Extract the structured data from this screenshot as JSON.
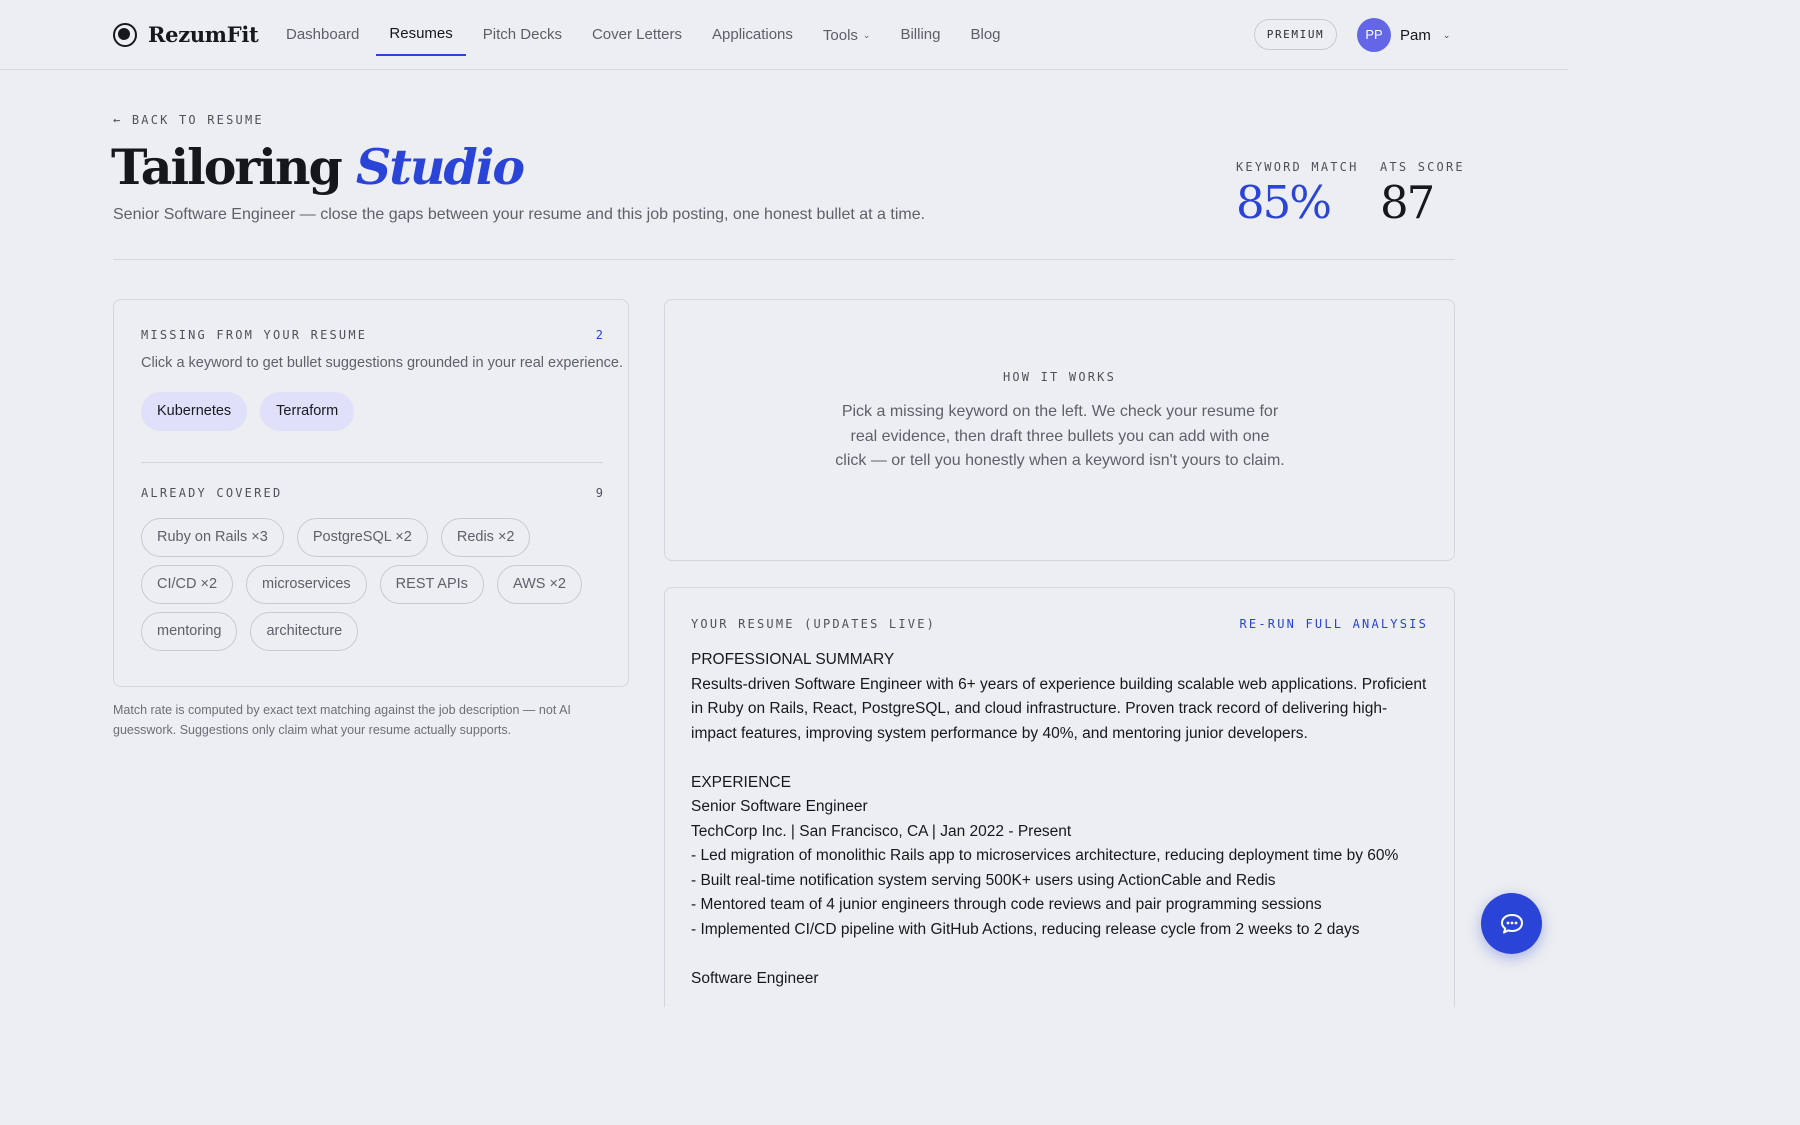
{
  "brand": {
    "name": "RezumFit",
    "logo_icon": "circle-logo-icon"
  },
  "nav": {
    "links": [
      {
        "label": "Dashboard",
        "active": false
      },
      {
        "label": "Resumes",
        "active": true
      },
      {
        "label": "Pitch Decks",
        "active": false
      },
      {
        "label": "Cover Letters",
        "active": false
      },
      {
        "label": "Applications",
        "active": false
      },
      {
        "label": "Tools",
        "active": false,
        "has_dropdown": true
      },
      {
        "label": "Billing",
        "active": false
      },
      {
        "label": "Blog",
        "active": false
      }
    ],
    "premium_label": "PREMIUM",
    "user": {
      "initials": "PP",
      "name": "Pam"
    }
  },
  "header": {
    "back_label": "← BACK TO RESUME",
    "title_plain": "Tailoring",
    "title_accent": "Studio",
    "subtitle": "Senior Software Engineer — close the gaps between your resume and this job posting, one honest bullet at a time.",
    "keyword_match_label": "KEYWORD MATCH",
    "keyword_match_value": "85%",
    "ats_score_label": "ATS SCORE",
    "ats_score_value": "87"
  },
  "missing": {
    "heading": "MISSING FROM YOUR RESUME",
    "count": "2",
    "description": "Click a keyword to get bullet suggestions grounded in your real experience.",
    "keywords": [
      "Kubernetes",
      "Terraform"
    ]
  },
  "covered": {
    "heading": "ALREADY COVERED",
    "count": "9",
    "keywords": [
      "Ruby on Rails ×3",
      "PostgreSQL ×2",
      "Redis ×2",
      "CI/CD ×2",
      "microservices",
      "REST APIs",
      "AWS ×2",
      "mentoring",
      "architecture"
    ]
  },
  "footnote": "Match rate is computed by exact text matching against the job description — not AI guesswork. Suggestions only claim what your resume actually supports.",
  "how_it_works": {
    "heading": "HOW IT WORKS",
    "text": "Pick a missing keyword on the left. We check your resume for real evidence, then draft three bullets you can add with one click — or tell you honestly when a keyword isn't yours to claim."
  },
  "resume": {
    "heading": "YOUR RESUME (UPDATES LIVE)",
    "rerun_label": "RE-RUN FULL ANALYSIS",
    "body": "PROFESSIONAL SUMMARY\nResults-driven Software Engineer with 6+ years of experience building scalable web applications. Proficient in Ruby on Rails, React, PostgreSQL, and cloud infrastructure. Proven track record of delivering high-impact features, improving system performance by 40%, and mentoring junior developers.\n\nEXPERIENCE\nSenior Software Engineer\nTechCorp Inc. | San Francisco, CA | Jan 2022 - Present\n- Led migration of monolithic Rails app to microservices architecture, reducing deployment time by 60%\n- Built real-time notification system serving 500K+ users using ActionCable and Redis\n- Mentored team of 4 junior engineers through code reviews and pair programming sessions\n- Implemented CI/CD pipeline with GitHub Actions, reducing release cycle from 2 weeks to 2 days\n\nSoftware Engineer"
  },
  "chat_fab": {
    "icon": "chat-bubble-icon"
  },
  "colors": {
    "accent": "#2a44d8",
    "background": "#eceef1",
    "avatar": "#6466e8",
    "missing_chip": "#dfe0f9"
  }
}
